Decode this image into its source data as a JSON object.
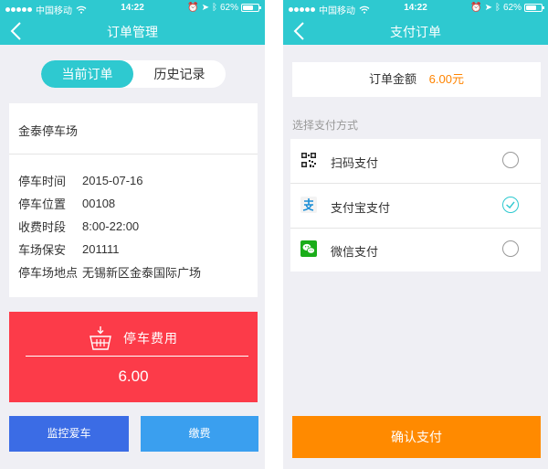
{
  "status_bar": {
    "carrier": "中国移动",
    "time": "14:22",
    "battery": "62%"
  },
  "left": {
    "nav_title": "订单管理",
    "tabs": [
      {
        "label": "当前订单"
      },
      {
        "label": "历史记录"
      }
    ],
    "lot_name": "金泰停车场",
    "rows": [
      {
        "label": "停车时间",
        "value": "2015-07-16"
      },
      {
        "label": "停车位置",
        "value": "00108"
      },
      {
        "label": "收费时段",
        "value": "8:00-22:00"
      },
      {
        "label": "车场保安",
        "value": "201111"
      },
      {
        "label": "停车场地点",
        "value": "无锡新区金泰国际广场"
      }
    ],
    "fee": {
      "title": "停车费用",
      "amount": "6.00"
    },
    "buttons": {
      "monitor": "监控爱车",
      "pay": "缴费"
    }
  },
  "right": {
    "nav_title": "支付订单",
    "amount_label": "订单金额",
    "amount_value": "6.00元",
    "method_label": "选择支付方式",
    "methods": [
      {
        "label": "扫码支付",
        "icon": "qr-code-icon",
        "selected": false
      },
      {
        "label": "支付宝支付",
        "icon": "alipay-icon",
        "selected": true
      },
      {
        "label": "微信支付",
        "icon": "wechat-icon",
        "selected": false
      }
    ],
    "confirm_label": "确认支付"
  },
  "colors": {
    "header": "#2ec9d0",
    "fee_red": "#fc3b49",
    "monitor_blue": "#3b6ce5",
    "pay_blue": "#3a9fef",
    "confirm_orange": "#ff8a00",
    "amount_orange": "#ff8400"
  }
}
